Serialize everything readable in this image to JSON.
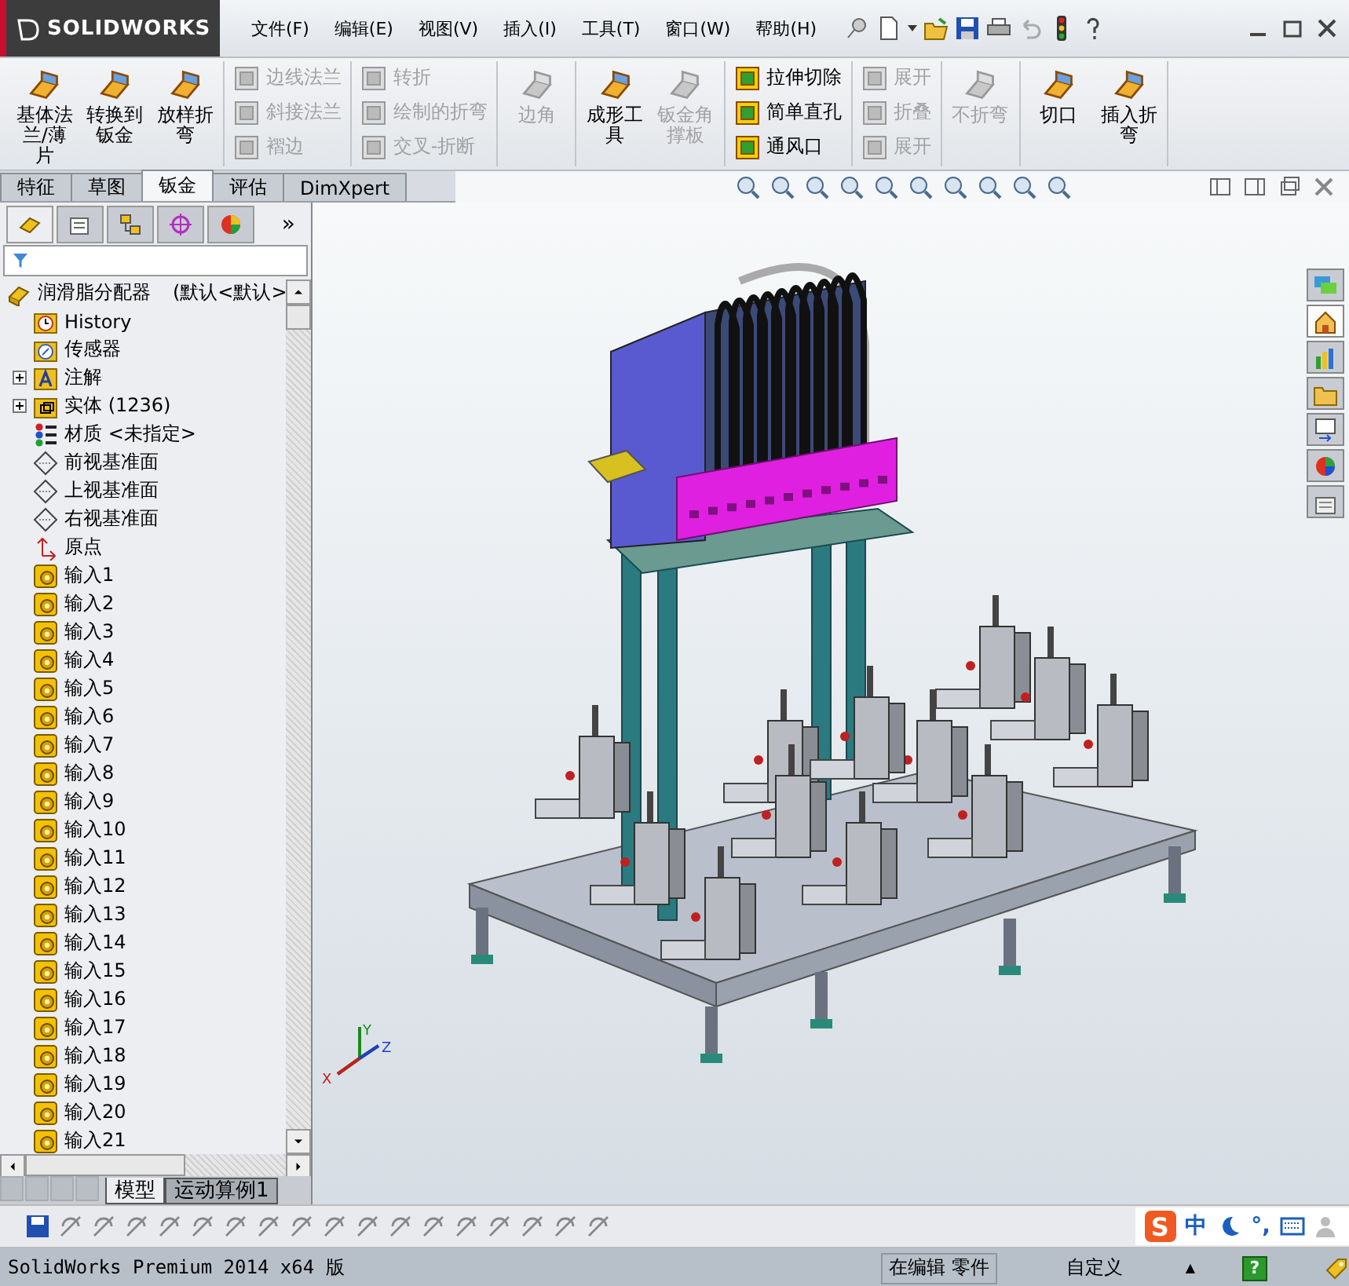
{
  "app": {
    "logo": "SOLIDWORKS"
  },
  "menu": [
    "文件(F)",
    "编辑(E)",
    "视图(V)",
    "插入(I)",
    "工具(T)",
    "窗口(W)",
    "帮助(H)"
  ],
  "ribbon": [
    {
      "kind": "large",
      "items": [
        {
          "label": "基体法兰/薄片",
          "disabled": false
        },
        {
          "label": "转换到钣金",
          "disabled": false
        },
        {
          "label": "放样折弯",
          "disabled": false
        }
      ]
    },
    {
      "kind": "small",
      "items": [
        {
          "label": "边线法兰",
          "disabled": true
        },
        {
          "label": "斜接法兰",
          "disabled": true
        },
        {
          "label": "褶边",
          "disabled": true
        }
      ]
    },
    {
      "kind": "small",
      "items": [
        {
          "label": "转折",
          "disabled": true
        },
        {
          "label": "绘制的折弯",
          "disabled": true
        },
        {
          "label": "交叉-折断",
          "disabled": true
        }
      ]
    },
    {
      "kind": "large",
      "items": [
        {
          "label": "边角",
          "disabled": true
        }
      ]
    },
    {
      "kind": "large",
      "items": [
        {
          "label": "成形工具",
          "disabled": false
        },
        {
          "label": "钣金角撑板",
          "disabled": true
        }
      ]
    },
    {
      "kind": "small",
      "items": [
        {
          "label": "拉伸切除",
          "disabled": false
        },
        {
          "label": "简单直孔",
          "disabled": false
        },
        {
          "label": "通风口",
          "disabled": false
        }
      ]
    },
    {
      "kind": "small",
      "items": [
        {
          "label": "展开",
          "disabled": true
        },
        {
          "label": "折叠",
          "disabled": true
        },
        {
          "label": "展开",
          "disabled": true
        }
      ]
    },
    {
      "kind": "large",
      "items": [
        {
          "label": "不折弯",
          "disabled": true
        }
      ]
    },
    {
      "kind": "large",
      "items": [
        {
          "label": "切口",
          "disabled": false
        },
        {
          "label": "插入折弯",
          "disabled": false
        }
      ]
    }
  ],
  "command_tabs": [
    {
      "label": "特征",
      "selected": false
    },
    {
      "label": "草图",
      "selected": false
    },
    {
      "label": "钣金",
      "selected": true
    },
    {
      "label": "评估",
      "selected": false
    },
    {
      "label": "DimXpert",
      "selected": false
    }
  ],
  "panel_more": "»",
  "tree": {
    "root": "润滑脂分配器",
    "configuration": "(默认<默认>",
    "items": [
      {
        "kind": "history",
        "label": "History",
        "expandable": false
      },
      {
        "kind": "sensor",
        "label": "传感器",
        "expandable": false
      },
      {
        "kind": "annotation",
        "label": "注解",
        "expandable": true
      },
      {
        "kind": "solid",
        "label": "实体 (1236)",
        "expandable": true
      },
      {
        "kind": "material",
        "label": "材质 <未指定>",
        "expandable": false
      },
      {
        "kind": "plane",
        "label": "前视基准面",
        "expandable": false
      },
      {
        "kind": "plane",
        "label": "上视基准面",
        "expandable": false
      },
      {
        "kind": "plane",
        "label": "右视基准面",
        "expandable": false
      },
      {
        "kind": "origin",
        "label": "原点",
        "expandable": false
      },
      {
        "kind": "import",
        "label": "输入1",
        "expandable": false
      },
      {
        "kind": "import",
        "label": "输入2",
        "expandable": false
      },
      {
        "kind": "import",
        "label": "输入3",
        "expandable": false
      },
      {
        "kind": "import",
        "label": "输入4",
        "expandable": false
      },
      {
        "kind": "import",
        "label": "输入5",
        "expandable": false
      },
      {
        "kind": "import",
        "label": "输入6",
        "expandable": false
      },
      {
        "kind": "import",
        "label": "输入7",
        "expandable": false
      },
      {
        "kind": "import",
        "label": "输入8",
        "expandable": false
      },
      {
        "kind": "import",
        "label": "输入9",
        "expandable": false
      },
      {
        "kind": "import",
        "label": "输入10",
        "expandable": false
      },
      {
        "kind": "import",
        "label": "输入11",
        "expandable": false
      },
      {
        "kind": "import",
        "label": "输入12",
        "expandable": false
      },
      {
        "kind": "import",
        "label": "输入13",
        "expandable": false
      },
      {
        "kind": "import",
        "label": "输入14",
        "expandable": false
      },
      {
        "kind": "import",
        "label": "输入15",
        "expandable": false
      },
      {
        "kind": "import",
        "label": "输入16",
        "expandable": false
      },
      {
        "kind": "import",
        "label": "输入17",
        "expandable": false
      },
      {
        "kind": "import",
        "label": "输入18",
        "expandable": false
      },
      {
        "kind": "import",
        "label": "输入19",
        "expandable": false
      },
      {
        "kind": "import",
        "label": "输入20",
        "expandable": false
      },
      {
        "kind": "import",
        "label": "输入21",
        "expandable": false
      }
    ]
  },
  "bottom_tabs": [
    {
      "label": "模型",
      "selected": true
    },
    {
      "label": "运动算例1",
      "selected": false
    }
  ],
  "task_pane": [
    {
      "selected": false
    },
    {
      "selected": true
    },
    {
      "selected": false
    },
    {
      "selected": false
    },
    {
      "selected": false
    },
    {
      "selected": false
    },
    {
      "selected": false
    }
  ],
  "triad": [
    "Y",
    "Z",
    "X"
  ],
  "ime": {
    "logo": "S",
    "mode": "中",
    "punct": "°,"
  },
  "status_bar": {
    "product": "SolidWorks Premium 2014 x64 版",
    "mode": "在编辑 零件",
    "units": "自定义",
    "units_caret": "▲",
    "help": "?"
  }
}
